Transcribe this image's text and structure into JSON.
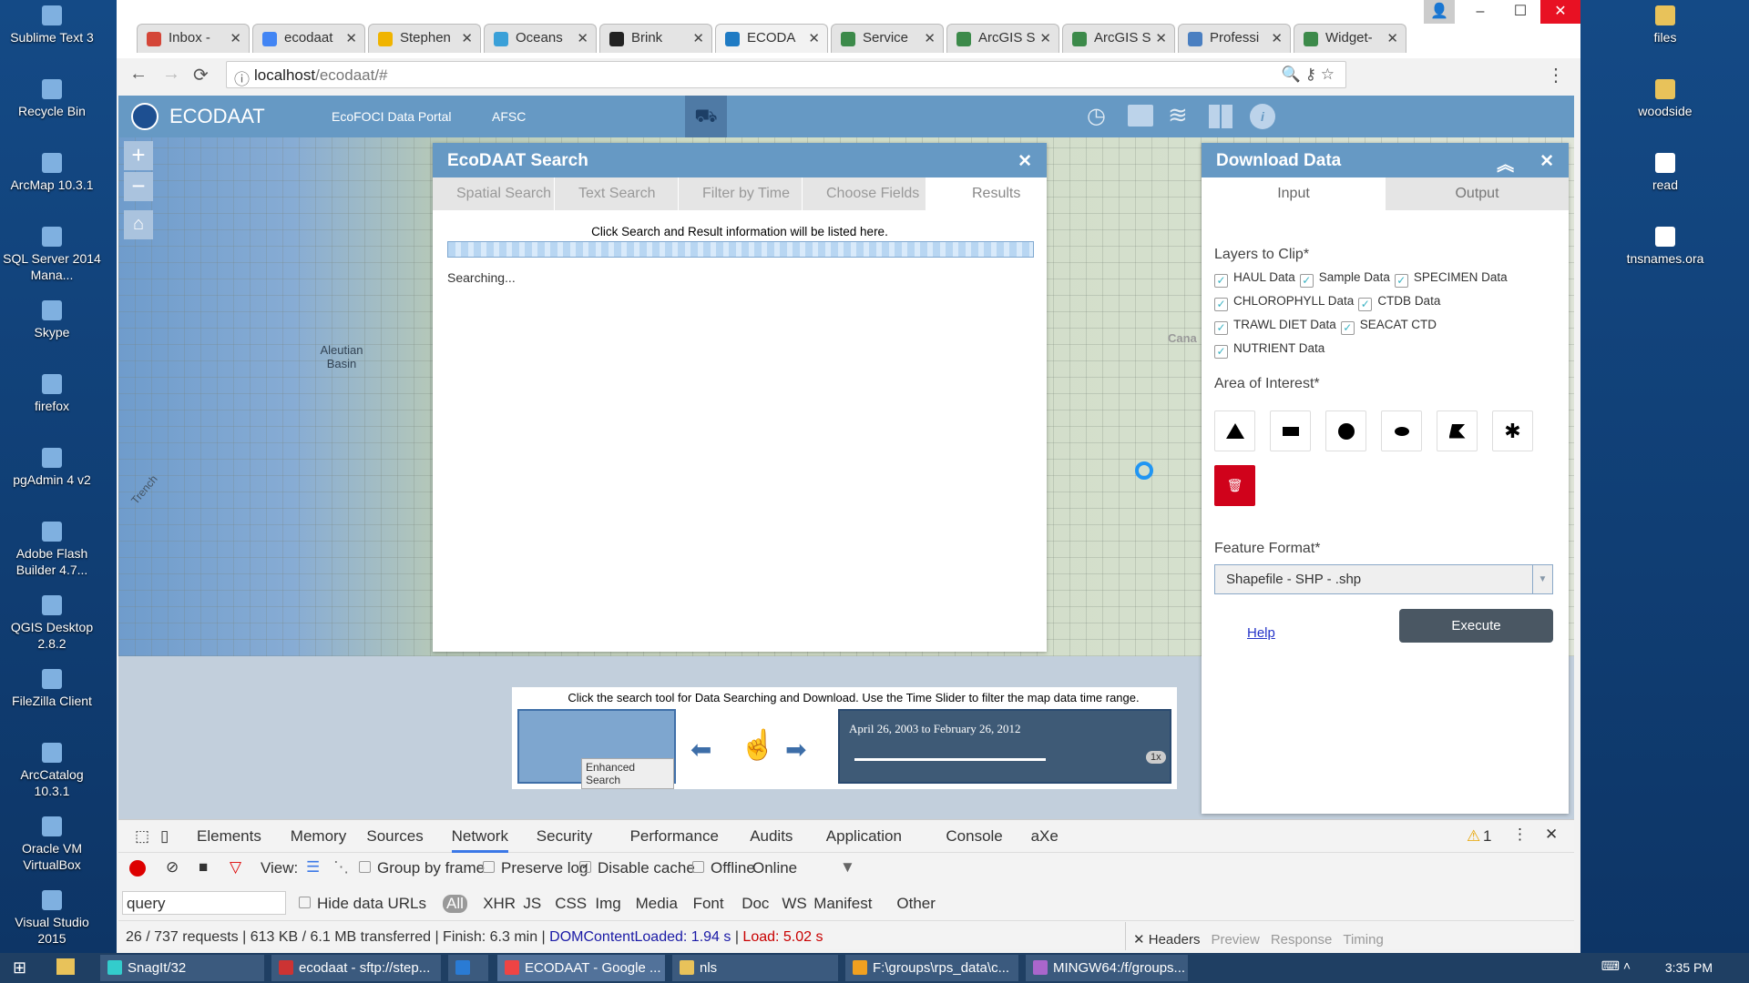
{
  "desktop": {
    "left": [
      "Sublime Text 3",
      "Recycle Bin",
      "ArcMap 10.3.1",
      "SQL Server 2014 Mana...",
      "Skype",
      "firefox",
      "pgAdmin 4 v2",
      "Adobe Flash Builder 4.7...",
      "QGIS Desktop 2.8.2",
      "FileZilla Client",
      "ArcCatalog 10.3.1",
      "Oracle VM VirtualBox",
      "Visual Studio 2015"
    ],
    "right": [
      "files",
      "woodside",
      "read",
      "tnsnames.ora"
    ]
  },
  "browser": {
    "tabs": [
      {
        "label": "Inbox -",
        "color": "#d44638"
      },
      {
        "label": "ecodaat",
        "color": "#4285f4"
      },
      {
        "label": "Stephen",
        "color": "#f0b400"
      },
      {
        "label": "Oceans",
        "color": "#3aa0d8"
      },
      {
        "label": "Brink",
        "color": "#222"
      },
      {
        "label": "ECODA",
        "color": "#1f7bc4"
      },
      {
        "label": "Service",
        "color": "#3c8a4a"
      },
      {
        "label": "ArcGIS S",
        "color": "#3c8a4a"
      },
      {
        "label": "ArcGIS S",
        "color": "#3c8a4a"
      },
      {
        "label": "Professi",
        "color": "#4a7fc1"
      },
      {
        "label": "Widget-",
        "color": "#3c8a4a"
      }
    ],
    "active_tab": 5,
    "url_host": "localhost",
    "url_path": "/ecodaat/#"
  },
  "app": {
    "title": "ECODAAT",
    "nav": [
      "EcoFOCI Data Portal",
      "AFSC"
    ],
    "map_label": "Aleutian Basin",
    "map_label2": "Trench",
    "map_label3": "Cana"
  },
  "search": {
    "title": "EcoDAAT Search",
    "tabs": [
      "Spatial Search",
      "Text Search",
      "Filter by Time",
      "Choose Fields",
      "Results"
    ],
    "info": "Click Search and Result information will be listed here.",
    "status": "Searching..."
  },
  "download": {
    "title": "Download Data",
    "tabs": [
      "Input",
      "Output"
    ],
    "layers_label": "Layers to Clip*",
    "layers": [
      [
        "HAUL Data",
        "Sample Data",
        "SPECIMEN Data"
      ],
      [
        "CHLOROPHYLL Data",
        "CTDB Data"
      ],
      [
        "TRAWL DIET Data",
        "SEACAT CTD"
      ],
      [
        "NUTRIENT Data"
      ]
    ],
    "aoi_label": "Area of Interest*",
    "format_label": "Feature Format*",
    "format_value": "Shapefile - SHP - .shp",
    "help": "Help",
    "execute": "Execute"
  },
  "help_banner": {
    "text": "Click the search tool for Data Searching and Download. Use the Time Slider to filter the map data time range.",
    "tooltip": "Enhanced Search",
    "time_range": "April 26, 2003 to February 26, 2012",
    "speed": "1x"
  },
  "devtools": {
    "tabs": [
      "Elements",
      "Memory",
      "Sources",
      "Network",
      "Security",
      "Performance",
      "Audits",
      "Application",
      "Console",
      "aXe"
    ],
    "active": "Network",
    "warnings": "1",
    "view": "View:",
    "group": "Group by frame",
    "preserve": "Preserve log",
    "disable_cache": "Disable cache",
    "offline": "Offline",
    "online": "Online",
    "filter": "query",
    "hide_urls": "Hide data URLs",
    "types": [
      "All",
      "XHR",
      "JS",
      "CSS",
      "Img",
      "Media",
      "Font",
      "Doc",
      "WS",
      "Manifest",
      "Other"
    ],
    "summary": "26 / 737 requests | 613 KB / 6.1 MB transferred | Finish: 6.3 min | ",
    "dcl": "DOMContentLoaded: 1.94 s",
    "sep": " | ",
    "load": "Load: 5.02 s",
    "detail_tabs": [
      "Headers",
      "Preview",
      "Response",
      "Timing"
    ]
  },
  "taskbar": {
    "items": [
      "SnagIt/32",
      "ecodaat - sftp://step...",
      "",
      "ECODAAT - Google ...",
      "nls",
      "F:\\groups\\rps_data\\c...",
      "MINGW64:/f/groups..."
    ],
    "time": "3:35 PM"
  }
}
